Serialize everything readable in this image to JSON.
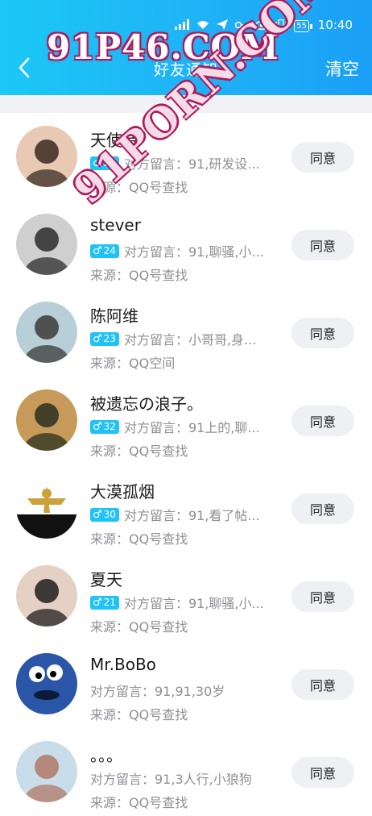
{
  "status": {
    "time": "10:40",
    "battery": "55",
    "net_label": "4G"
  },
  "header": {
    "title": "好友通知",
    "clear_label": "清空"
  },
  "watermarks": {
    "top": "91P46.COM",
    "diagonal": "91PORN.COM"
  },
  "colors": {
    "header_start": "#1cc8f6",
    "header_end": "#1a9ff5",
    "badge": "#20c3f5",
    "button_bg": "#eef0f4"
  },
  "requests": [
    {
      "name": "天使音",
      "gender": "male",
      "age": "27",
      "message": "对方留言：91,研发设...",
      "source": "来源：QQ号查找",
      "action": "同意",
      "avatar": "avatar-photo"
    },
    {
      "name": "stever",
      "gender": "male",
      "age": "24",
      "message": "对方留言：91,聊骚,小...",
      "source": "来源：QQ号查找",
      "action": "同意",
      "avatar": "avatar-photo"
    },
    {
      "name": "陈阿维",
      "gender": "male",
      "age": "23",
      "message": "对方留言：小哥哥,身...",
      "source": "来源：QQ空间",
      "action": "同意",
      "avatar": "avatar-photo"
    },
    {
      "name": "被遗忘の浪子。",
      "gender": "male",
      "age": "32",
      "message": "对方留言：91上的,聊...",
      "source": "来源：QQ号查找",
      "action": "同意",
      "avatar": "avatar-photo"
    },
    {
      "name": "大漠孤烟",
      "gender": "male",
      "age": "30",
      "message": "对方留言：91,看了帖...",
      "source": "来源：QQ号查找",
      "action": "同意",
      "avatar": "avatar-emblem"
    },
    {
      "name": "夏天",
      "gender": "male",
      "age": "21",
      "message": "对方留言：91,聊骚,小...",
      "source": "来源：QQ号查找",
      "action": "同意",
      "avatar": "avatar-photo"
    },
    {
      "name": "Mr.BoBo",
      "gender": "",
      "age": "",
      "message": "对方留言：91,91,30岁",
      "source": "来源：QQ号查找",
      "action": "同意",
      "avatar": "avatar-cartoon"
    },
    {
      "name": "。。。",
      "gender": "",
      "age": "",
      "message": "对方留言：91,3人行,小狼狗",
      "source": "来源：QQ号查找",
      "action": "同意",
      "avatar": "avatar-photo"
    }
  ]
}
